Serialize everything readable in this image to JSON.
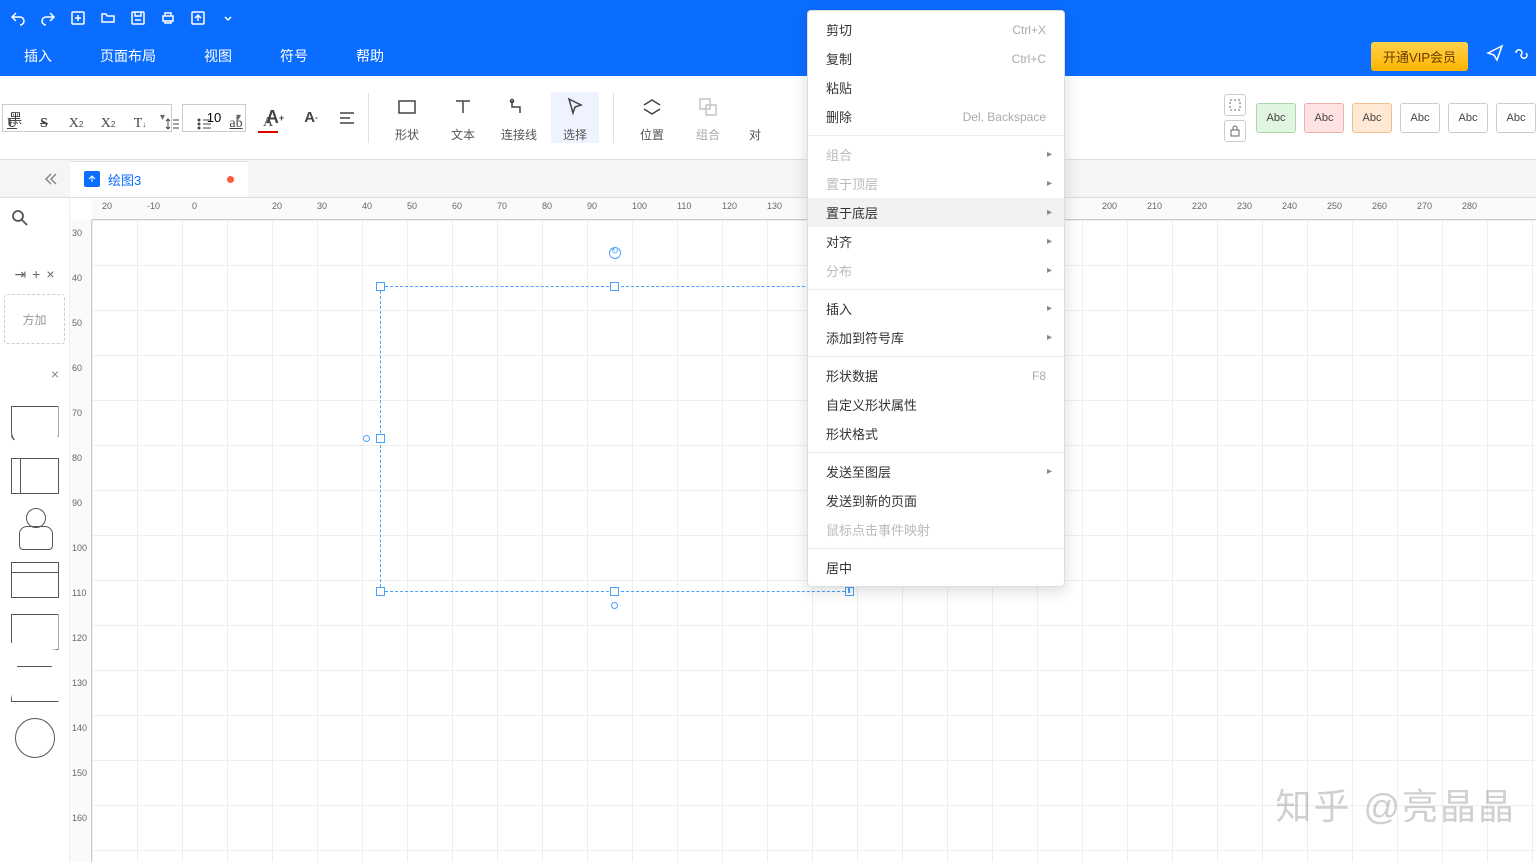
{
  "menubar": {
    "items": [
      "插入",
      "页面布局",
      "视图",
      "符号",
      "帮助"
    ],
    "vip": "开通VIP会员"
  },
  "ribbon": {
    "font": "黑",
    "size": "10",
    "tools": {
      "shape": "形状",
      "text": "文本",
      "connector": "连接线",
      "select": "选择",
      "position": "位置",
      "group": "组合",
      "align": "对"
    }
  },
  "stylebox_label": "Abc",
  "tab": {
    "name": "绘图3"
  },
  "leftpanel": {
    "add_hint": "方加"
  },
  "ruler_h": [
    "20",
    "-10",
    "0",
    "20",
    "30",
    "40",
    "50",
    "60",
    "70",
    "80",
    "90",
    "100",
    "110",
    "120",
    "130",
    "200",
    "210",
    "220",
    "230",
    "240",
    "250",
    "260",
    "270",
    "280"
  ],
  "ruler_v": [
    "30",
    "40",
    "50",
    "60",
    "70",
    "80",
    "90",
    "100",
    "110",
    "120",
    "130",
    "140",
    "150",
    "160"
  ],
  "context_menu": [
    {
      "label": "剪切",
      "shortcut": "Ctrl+X"
    },
    {
      "label": "复制",
      "shortcut": "Ctrl+C"
    },
    {
      "label": "粘贴"
    },
    {
      "label": "删除",
      "shortcut": "Del, Backspace"
    },
    {
      "sep": true
    },
    {
      "label": "组合",
      "sub": true,
      "disabled": true
    },
    {
      "label": "置于顶层",
      "sub": true,
      "disabled": true
    },
    {
      "label": "置于底层",
      "sub": true,
      "hover": true
    },
    {
      "label": "对齐",
      "sub": true
    },
    {
      "label": "分布",
      "sub": true,
      "disabled": true
    },
    {
      "sep": true
    },
    {
      "label": "插入",
      "sub": true
    },
    {
      "label": "添加到符号库",
      "sub": true
    },
    {
      "sep": true
    },
    {
      "label": "形状数据",
      "shortcut": "F8"
    },
    {
      "label": "自定义形状属性"
    },
    {
      "label": "形状格式"
    },
    {
      "sep": true
    },
    {
      "label": "发送至图层",
      "sub": true
    },
    {
      "label": "发送到新的页面"
    },
    {
      "label": "鼠标点击事件映射",
      "disabled": true
    },
    {
      "sep": true
    },
    {
      "label": "居中"
    }
  ],
  "watermark": "知乎 @亮晶晶"
}
